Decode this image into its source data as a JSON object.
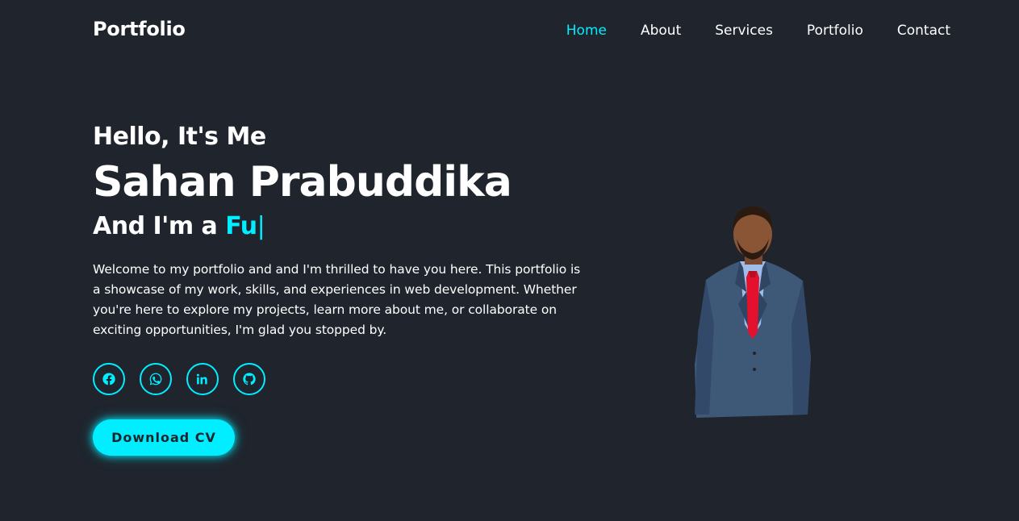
{
  "header": {
    "logo": "Portfolio",
    "nav": [
      {
        "label": "Home",
        "active": true
      },
      {
        "label": "About",
        "active": false
      },
      {
        "label": "Services",
        "active": false
      },
      {
        "label": "Portfolio",
        "active": false
      },
      {
        "label": "Contact",
        "active": false
      }
    ]
  },
  "home": {
    "greeting": "Hello, It's Me",
    "name": "Sahan Prabuddika",
    "role_prefix": "And I'm a ",
    "role_typed": "Fu",
    "cursor": "|",
    "intro": "Welcome to my portfolio and and I'm thrilled to have you here. This portfolio is a showcase of my work, skills, and experiences in web development. Whether you're here to explore my projects, learn more about me, or collaborate on exciting opportunities, I'm glad you stopped by.",
    "socials": [
      {
        "icon": "facebook-icon"
      },
      {
        "icon": "whatsapp-icon"
      },
      {
        "icon": "linkedin-icon"
      },
      {
        "icon": "github-icon"
      }
    ],
    "cta_label": "Download CV"
  },
  "colors": {
    "background": "#1f242d",
    "accent": "#00eeff",
    "text": "#ffffff"
  }
}
